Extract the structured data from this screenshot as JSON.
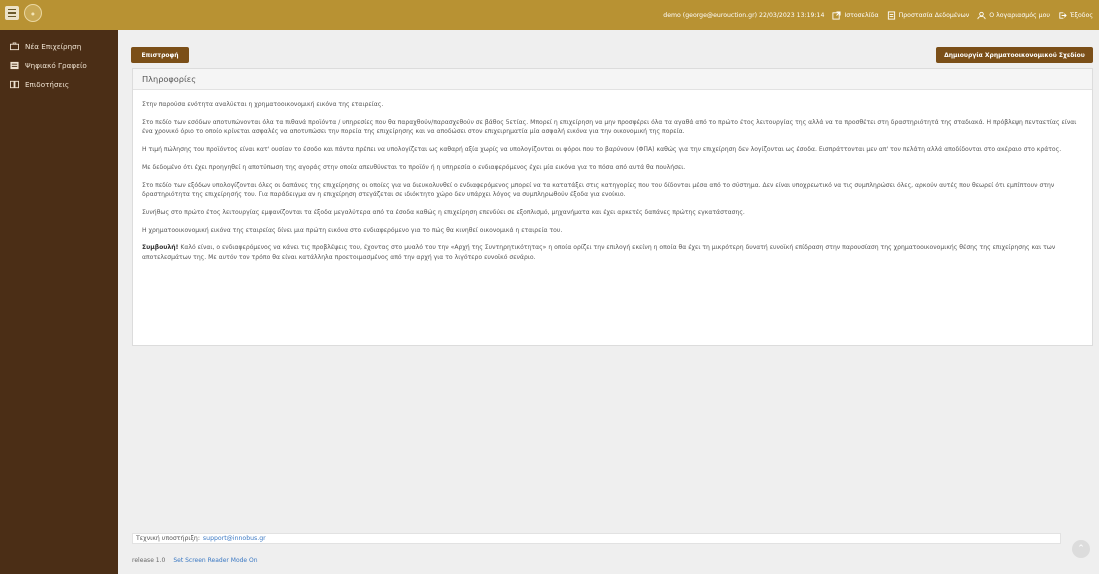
{
  "topbar": {
    "user_info": "demo (george@eurouction.gr) 22/03/2023 13:19:14",
    "website": "Ιστοσελίδα",
    "data_protection": "Προστασία Δεδομένων",
    "account": "Ο λογαριασμός μου",
    "logout": "Έξοδος"
  },
  "sidebar": {
    "items": [
      {
        "label": "Νέα Επιχείρηση",
        "icon": "briefcase-icon"
      },
      {
        "label": "Ψηφιακό Γραφείο",
        "icon": "board-icon"
      },
      {
        "label": "Επιδοτήσεις",
        "icon": "book-icon"
      }
    ]
  },
  "main": {
    "back_label": "Επιστροφή",
    "create_label": "Δημιουργία Χρηματοοικονομικού Σχεδίου",
    "panel_title": "Πληροφορίες",
    "paragraphs": [
      "Στην παρούσα ενότητα αναλύεται η χρηματοοικονομική εικόνα της εταιρείας.",
      "Στο πεδίο των εσόδων αποτυπώνονται όλα τα πιθανά προϊόντα / υπηρεσίες που θα παραχθούν/παρασχεθούν σε βάθος 5ετίας. Μπορεί η επιχείρηση να μην προσφέρει όλα τα αγαθά από το πρώτο έτος λειτουργίας της αλλά να τα προσθέτει στη δραστηριότητά της σταδιακά. Η πρόβλεψη πενταετίας είναι ένα χρονικό όριο το οποίο κρίνεται ασφαλές να αποτυπώσει την πορεία της επιχείρησης και να αποδώσει στον επιχειρηματία μία ασφαλή εικόνα για την οικονομική της πορεία.",
      "Η τιμή πώλησης του προϊόντος είναι κατ' ουσίαν το έσοδο και πάντα πρέπει να υπολογίζεται ως καθαρή αξία χωρίς να υπολογίζονται οι φόροι που το βαρύνουν (ΦΠΑ) καθώς για την επιχείρηση δεν λογίζονται ως έσοδα. Εισπράττονται μεν απ' τον πελάτη αλλά αποδίδονται στο ακέραιο στο κράτος.",
      "Με δεδομένο ότι έχει προηγηθεί η αποτύπωση της αγοράς στην οποία απευθύνεται το προϊόν ή η υπηρεσία ο ενδιαφερόμενος έχει μία εικόνα για το πόσα από αυτά θα πουλήσει.",
      "Στο πεδίο των εξόδων υπολογίζονται όλες οι δαπάνες της επιχείρησης οι οποίες για να διευκολυνθεί ο ενδιαφερόμενος μπορεί να τα κατατάξει στις κατηγορίες που του δίδονται μέσα από το σύστημα. Δεν είναι υποχρεωτικό να τις συμπληρώσει όλες, αρκούν αυτές που θεωρεί ότι εμπίπτουν στην δραστηριότητα της επιχείρησής του. Για παράδειγμα αν η επιχείρηση στεγάζεται σε ιδιόκτητο χώρο δεν υπάρχει λόγος να συμπληρωθούν έξοδα για ενοίκιο.",
      "Συνήθως στο πρώτο έτος λειτουργίας εμφανίζονται τα έξοδα μεγαλύτερα από τα έσοδα καθώς η επιχείρηση επενδύει σε εξοπλισμό, μηχανήματα και έχει αρκετές δαπάνες πρώτης εγκατάστασης.",
      "Η χρηματοοικονομική εικόνα της εταιρείας δίνει μια πρώτη εικόνα στο ενδιαφερόμενο για το πώς θα κινηθεί οικονομικά η εταιρεία του."
    ],
    "tip_label": "Συμβουλή!",
    "tip_text": " Καλό είναι, ο ενδιαφερόμενος να κάνει τις προβλέψεις του, έχοντας στο μυαλό του την «Αρχή της Συντηρητικότητας» η οποία ορίζει την επιλογή εκείνη η οποία θα έχει τη μικρότερη δυνατή ευνοϊκή επίδραση στην παρουσίαση της χρηματοοικονομικής θέσης της επιχείρησης και των αποτελεσμάτων της. Με αυτόν τον τρόπο θα είναι κατάλληλα προετοιμασμένος από την αρχή για το λιγότερο ευνοϊκό σενάριο."
  },
  "footer": {
    "support_label": "Τεχνική υποστήριξη:",
    "support_email": "support@innobus.gr",
    "release": "release 1.0",
    "screen_reader": "Set Screen Reader Mode On"
  }
}
